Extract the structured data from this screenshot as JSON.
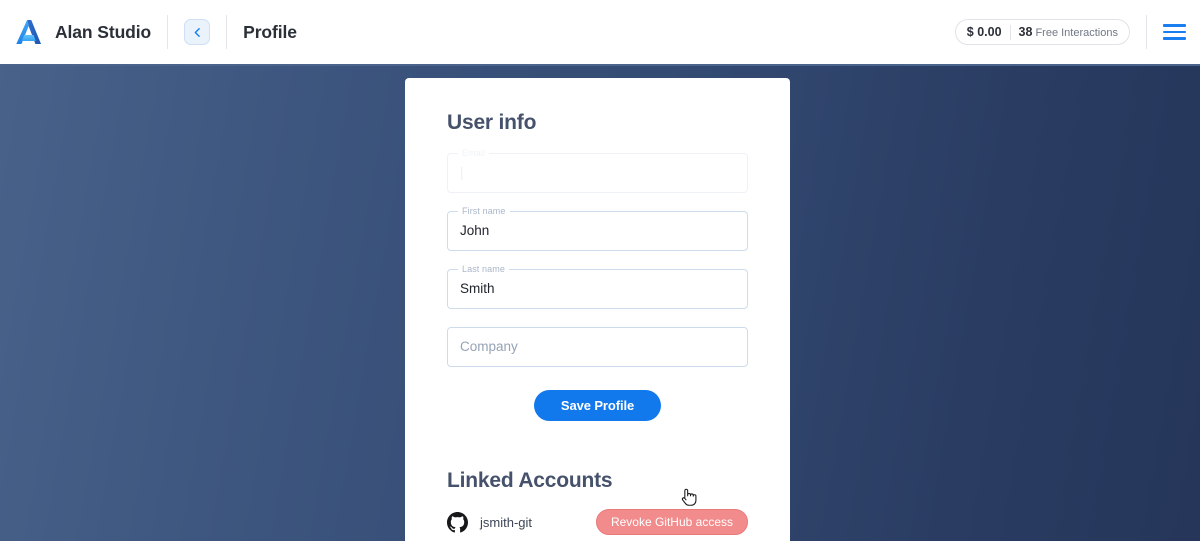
{
  "topbar": {
    "logo_icon": "alan-logo-icon",
    "brand_name": "Alan Studio",
    "back_icon": "chevron-left-icon",
    "page_title": "Profile",
    "credit_amount": "$ 0.00",
    "credit_count": "38",
    "credit_label": "Free Interactions",
    "menu_icon": "hamburger-menu-icon"
  },
  "card": {
    "user_info": {
      "title": "User info",
      "fields": [
        {
          "legend": "Email",
          "value": "|",
          "placeholder": "",
          "disabled": true
        },
        {
          "legend": "First name",
          "value": "John",
          "placeholder": "",
          "disabled": false
        },
        {
          "legend": "Last name",
          "value": "Smith",
          "placeholder": "",
          "disabled": false
        },
        {
          "legend": "",
          "value": "",
          "placeholder": "Company",
          "disabled": false
        }
      ],
      "save_label": "Save Profile"
    },
    "linked_accounts": {
      "title": "Linked Accounts",
      "provider_icon": "github-icon",
      "username": "jsmith-git",
      "revoke_label": "Revoke GitHub access"
    }
  },
  "colors": {
    "accent_blue": "#1279ed",
    "danger_red": "#f28b8b",
    "background_left": "#48628a",
    "background_right": "#25365a",
    "heading": "#46526b"
  }
}
